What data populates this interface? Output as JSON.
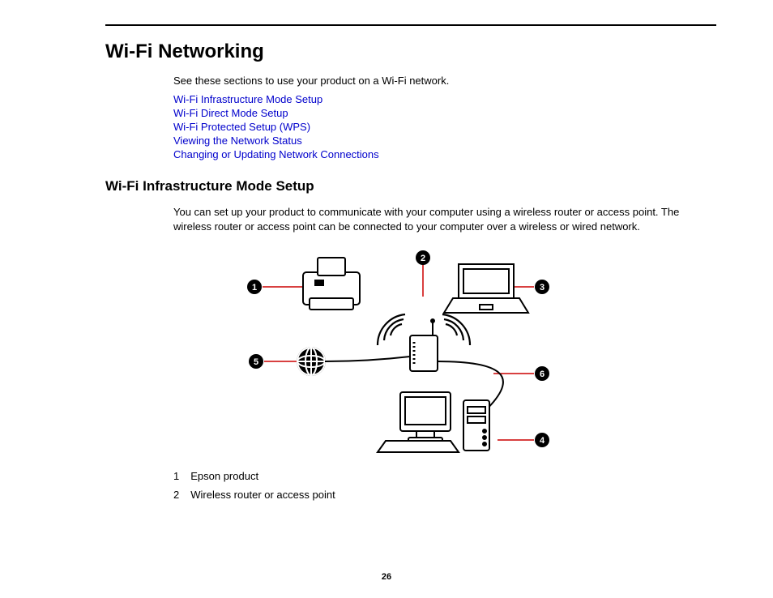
{
  "page": {
    "title": "Wi-Fi Networking",
    "intro": "See these sections to use your product on a Wi-Fi network.",
    "links": [
      "Wi-Fi Infrastructure Mode Setup",
      "Wi-Fi Direct Mode Setup",
      "Wi-Fi Protected Setup (WPS)",
      "Viewing the Network Status",
      "Changing or Updating Network Connections"
    ],
    "section": {
      "heading": "Wi-Fi Infrastructure Mode Setup",
      "body": "You can set up your product to communicate with your computer using a wireless router or access point. The wireless router or access point can be connected to your computer over a wireless or wired network."
    },
    "diagram": {
      "callouts": [
        "1",
        "2",
        "3",
        "4",
        "5",
        "6"
      ]
    },
    "legend": [
      {
        "num": "1",
        "text": "Epson product"
      },
      {
        "num": "2",
        "text": "Wireless router or access point"
      }
    ],
    "page_number": "26"
  }
}
